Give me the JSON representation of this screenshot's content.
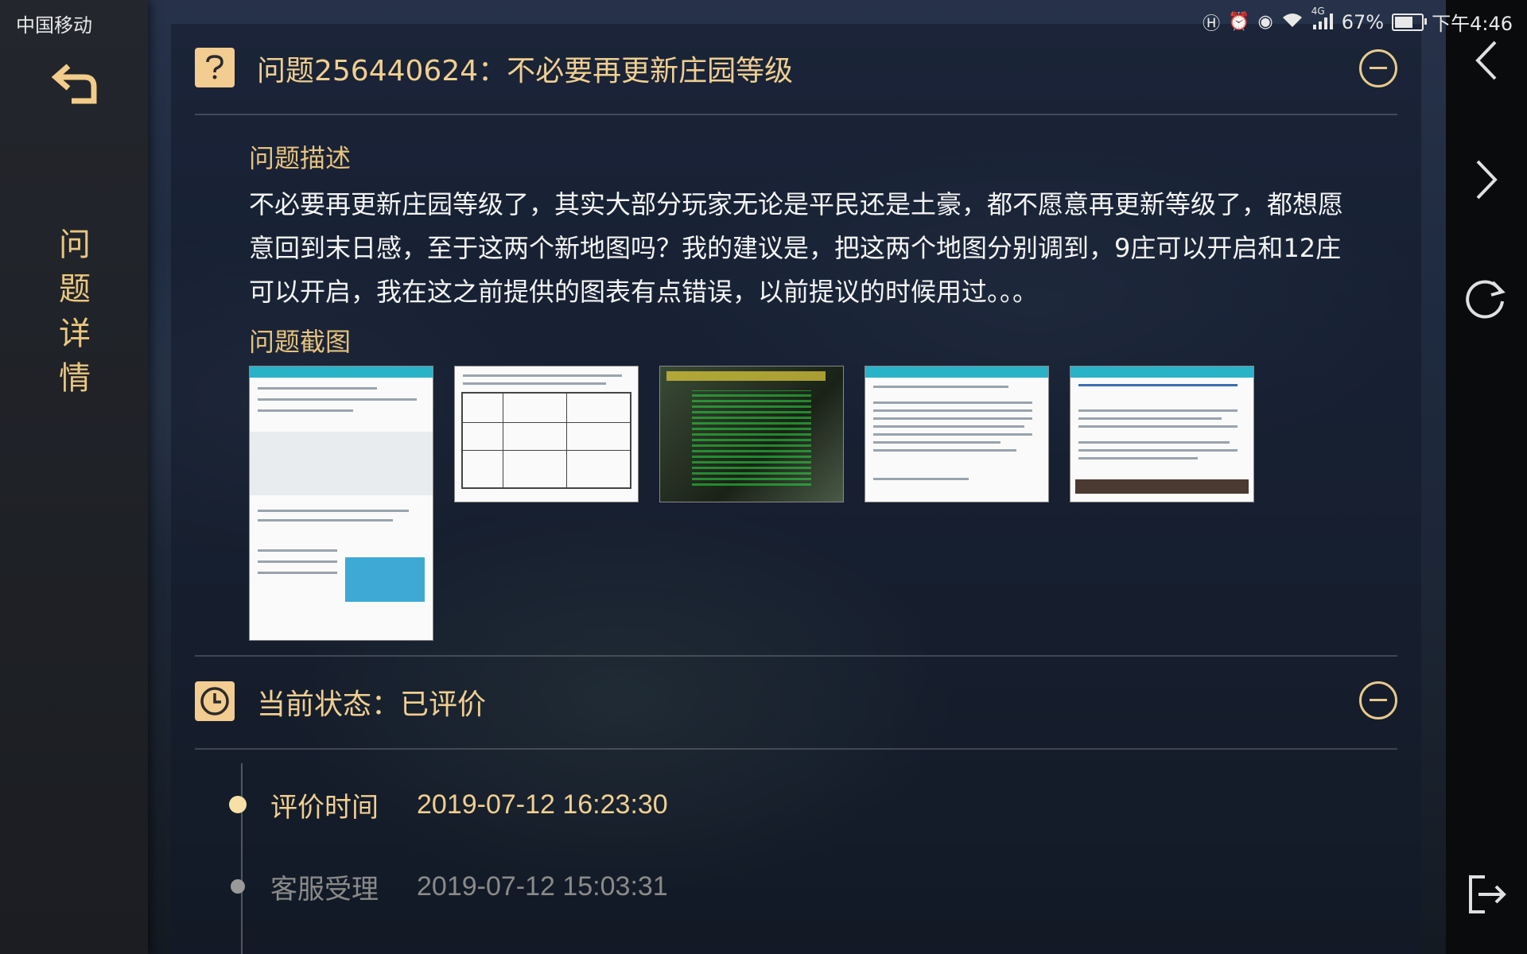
{
  "status_bar": {
    "carrier": "中国移动",
    "battery": "67%",
    "network": "4G",
    "time": "下午4:46"
  },
  "sidebar": {
    "title_chars": [
      "问",
      "题",
      "详",
      "情"
    ]
  },
  "problem": {
    "title": "问题256440624：不必要再更新庄园等级",
    "description_label": "问题描述",
    "description": "不必要再更新庄园等级了，其实大部分玩家无论是平民还是土豪，都不愿意再更新等级了，都想愿意回到末日感，至于这两个新地图吗？我的建议是，把这两个地图分别调到，9庄可以开启和12庄可以开启，我在这之前提供的图表有点错误，以前提议的时候用过。。。",
    "screenshots_label": "问题截图"
  },
  "status": {
    "title": "当前状态：已评价",
    "timeline": [
      {
        "label": "评价时间",
        "time": "2019-07-12 16:23:30"
      },
      {
        "label": "客服受理",
        "time": "2019-07-12 15:03:31"
      }
    ]
  },
  "colors": {
    "accent": "#f0cf90",
    "text_light": "#f4f4f4",
    "muted": "#8a8a8a"
  }
}
